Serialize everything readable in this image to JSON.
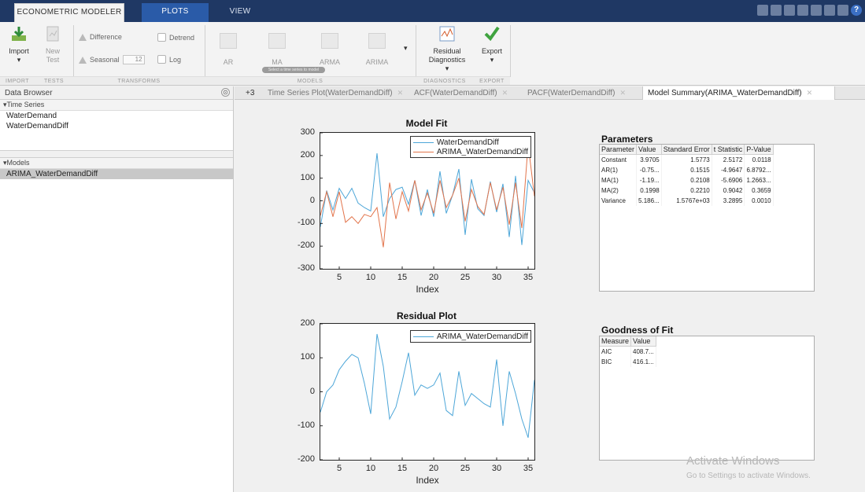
{
  "ribbon_tabs": [
    "ECONOMETRIC MODELER",
    "PLOTS",
    "VIEW"
  ],
  "help_glyph": "?",
  "ribbon": {
    "import_label": "Import",
    "new_test_label": "New Test",
    "difference_label": "Difference",
    "seasonal_label": "Seasonal",
    "seasonal_value": "12",
    "detrend_label": "Detrend",
    "log_label": "Log",
    "models": [
      "AR",
      "MA",
      "ARMA",
      "ARIMA"
    ],
    "tooltip_text": "Select a time series to model",
    "residual_label": "Residual Diagnostics",
    "export_label": "Export",
    "groups": [
      "IMPORT",
      "TESTS",
      "TRANSFORMS",
      "MODELS",
      "DIAGNOSTICS",
      "EXPORT"
    ]
  },
  "browser": {
    "title": "Data Browser",
    "options_glyph": "⊙",
    "time_series_header": "▾Time Series",
    "time_series": [
      "WaterDemand",
      "WaterDemandDiff"
    ],
    "models_header": "▾Models",
    "models": [
      "ARIMA_WaterDemandDiff"
    ]
  },
  "doc_tabs": {
    "overflow": "+3",
    "tabs": [
      "Time Series Plot(WaterDemandDiff)",
      "ACF(WaterDemandDiff)",
      "PACF(WaterDemandDiff)",
      "Model Summary(ARIMA_WaterDemandDiff)"
    ],
    "close_glyph": "✕"
  },
  "chart_data": [
    {
      "type": "line",
      "title": "Model Fit",
      "xlabel": "Index",
      "ylabel": "",
      "xlim": [
        2,
        36
      ],
      "ylim": [
        -300,
        300
      ],
      "xticks": [
        "5",
        "10",
        "15",
        "20",
        "25",
        "30",
        "35"
      ],
      "yticks": [
        "300",
        "200",
        "100",
        "0",
        "-100",
        "-200",
        "-300"
      ],
      "x": [
        2,
        3,
        4,
        5,
        6,
        7,
        8,
        9,
        10,
        11,
        12,
        13,
        14,
        15,
        16,
        17,
        18,
        19,
        20,
        21,
        22,
        23,
        24,
        25,
        26,
        27,
        28,
        29,
        30,
        31,
        32,
        33,
        34,
        35,
        36
      ],
      "legend_position": "top-right",
      "series": [
        {
          "name": "WaterDemandDiff",
          "color": "#4da6d8",
          "values": [
            -115,
            45,
            -40,
            55,
            10,
            55,
            -10,
            -30,
            -45,
            210,
            -70,
            10,
            50,
            60,
            -15,
            90,
            -65,
            50,
            -70,
            130,
            -55,
            25,
            140,
            -150,
            95,
            -35,
            -65,
            85,
            -50,
            75,
            -160,
            110,
            -195,
            90,
            35
          ]
        },
        {
          "name": "ARIMA_WaterDemandDiff",
          "color": "#e2744b",
          "values": [
            -65,
            40,
            -70,
            40,
            -95,
            -70,
            -100,
            -60,
            -70,
            -30,
            -205,
            80,
            -80,
            40,
            -45,
            90,
            -40,
            35,
            -55,
            90,
            -30,
            25,
            100,
            -90,
            50,
            -25,
            -60,
            80,
            -40,
            60,
            -105,
            80,
            -120,
            250,
            20
          ]
        }
      ]
    },
    {
      "type": "line",
      "title": "Residual Plot",
      "xlabel": "Index",
      "ylabel": "",
      "xlim": [
        2,
        36
      ],
      "ylim": [
        -200,
        200
      ],
      "xticks": [
        "5",
        "10",
        "15",
        "20",
        "25",
        "30",
        "35"
      ],
      "yticks": [
        "200",
        "100",
        "0",
        "-100",
        "-200"
      ],
      "x": [
        2,
        3,
        4,
        5,
        6,
        7,
        8,
        9,
        10,
        11,
        12,
        13,
        14,
        15,
        16,
        17,
        18,
        19,
        20,
        21,
        22,
        23,
        24,
        25,
        26,
        27,
        28,
        29,
        30,
        31,
        32,
        33,
        34,
        35,
        36
      ],
      "legend_position": "top-right",
      "series": [
        {
          "name": "ARIMA_WaterDemandDiff",
          "color": "#4da6d8",
          "values": [
            -60,
            0,
            20,
            65,
            90,
            110,
            100,
            25,
            -65,
            170,
            75,
            -80,
            -45,
            30,
            115,
            -10,
            20,
            10,
            20,
            55,
            -55,
            -70,
            60,
            -40,
            -5,
            -20,
            -35,
            -45,
            95,
            -100,
            60,
            -5,
            -80,
            -135,
            35
          ]
        }
      ]
    }
  ],
  "parameters": {
    "title": "Parameters",
    "headers": [
      "Parameter",
      "Value",
      "Standard Error",
      "t Statistic",
      "P-Value"
    ],
    "rows": [
      [
        "Constant",
        "3.9705",
        "1.5773",
        "2.5172",
        "0.0118"
      ],
      [
        "AR(1)",
        "-0.75...",
        "0.1515",
        "-4.9647",
        "6.8792..."
      ],
      [
        "MA(1)",
        "-1.19...",
        "0.2108",
        "-5.6906",
        "1.2663..."
      ],
      [
        "MA(2)",
        "0.1998",
        "0.2210",
        "0.9042",
        "0.3659"
      ],
      [
        "Variance",
        "5.186...",
        "1.5767e+03",
        "3.2895",
        "0.0010"
      ]
    ]
  },
  "goodness": {
    "title": "Goodness of Fit",
    "headers": [
      "Measure",
      "Value"
    ],
    "rows": [
      [
        "AIC",
        "408.7..."
      ],
      [
        "BIC",
        "416.1..."
      ]
    ]
  },
  "watermark": {
    "line1": "Activate Windows",
    "line2": "Go to Settings to activate Windows."
  }
}
